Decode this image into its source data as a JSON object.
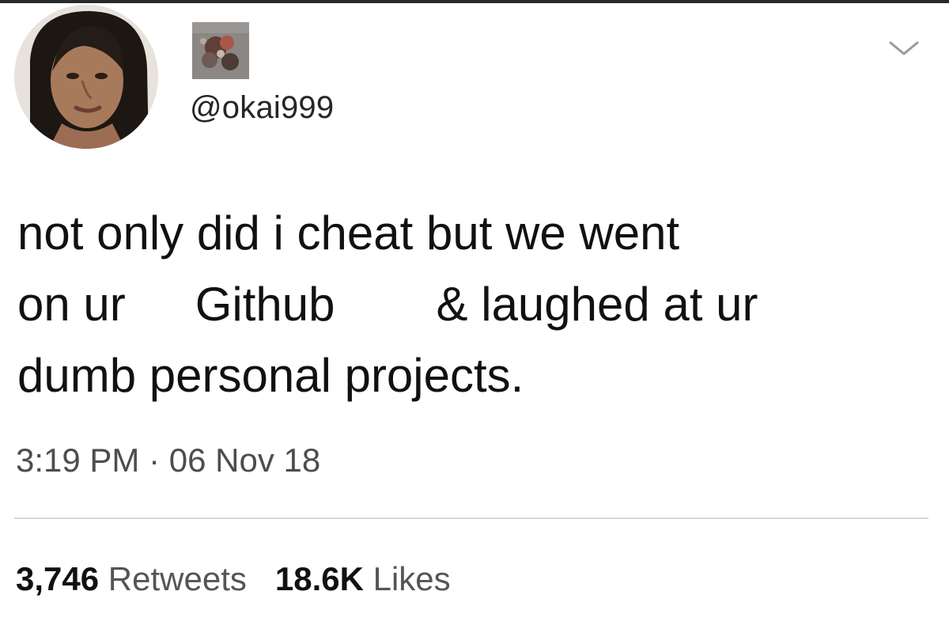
{
  "tweet": {
    "handle": "@okai999",
    "text": {
      "line1": "not only did i cheat but we went",
      "line2_a": "on ur",
      "line2_b": "Github",
      "line2_c": "& laughed at ur",
      "line3": "dumb personal projects."
    },
    "timestamp": "3:19 PM · 06 Nov 18",
    "stats": {
      "retweets_count": "3,746",
      "retweets_label": "Retweets",
      "likes_count": "18.6K",
      "likes_label": "Likes"
    }
  },
  "icons": {
    "menu": "chevron-down-icon",
    "avatar": "profile-photo",
    "header_image": "header-thumbnail"
  },
  "colors": {
    "text": "#111111",
    "muted": "#555555",
    "divider": "#d7d7d7",
    "background": "#ffffff"
  }
}
